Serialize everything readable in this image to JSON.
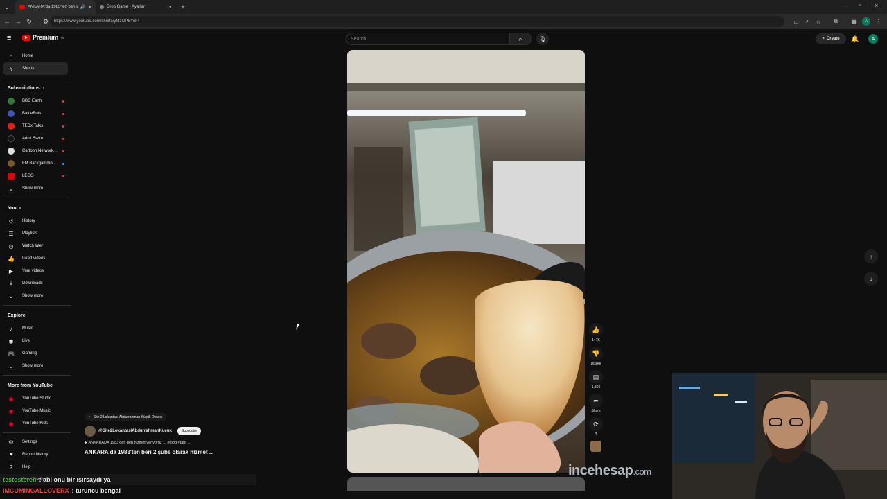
{
  "browser": {
    "tabs": [
      {
        "title": "ANKARA'da 1983'ten beri 2",
        "active": true
      },
      {
        "title": "Drop Game - Ayarlar",
        "active": false
      }
    ],
    "url": "https://www.youtube.com/shorts/yMzI2PEYek4"
  },
  "header": {
    "logo_text": "Premium",
    "logo_badge": "TR",
    "search_placeholder": "Search",
    "create_label": "Create",
    "avatar_letter": "A",
    "brand_color": "#ff0000"
  },
  "sidebar": {
    "main": [
      {
        "label": "Home",
        "icon": "home-icon"
      },
      {
        "label": "Shorts",
        "icon": "shorts-icon",
        "active": true
      }
    ],
    "subscriptions_title": "Subscriptions",
    "subscriptions": [
      {
        "label": "BBC Earth",
        "color": "#2e7d32"
      },
      {
        "label": "BattleBots",
        "color": "#3f51b5"
      },
      {
        "label": "TEDx Talks",
        "color": "#e62117"
      },
      {
        "label": "Adult Swim",
        "color": "#111111"
      },
      {
        "label": "Cartoon Network...",
        "color": "#dddddd"
      },
      {
        "label": "FM Backgammo...",
        "color": "#7a5a2a"
      },
      {
        "label": "LEGO",
        "color": "#e3000b"
      }
    ],
    "subs_show_more": "Show more",
    "you_title": "You",
    "you_items": [
      {
        "label": "History",
        "icon": "history-icon"
      },
      {
        "label": "Playlists",
        "icon": "playlists-icon"
      },
      {
        "label": "Watch later",
        "icon": "clock-icon"
      },
      {
        "label": "Liked videos",
        "icon": "thumbs-up-icon"
      },
      {
        "label": "Your videos",
        "icon": "video-icon"
      },
      {
        "label": "Downloads",
        "icon": "download-icon"
      }
    ],
    "you_show_more": "Show more",
    "explore_title": "Explore",
    "explore_items": [
      {
        "label": "Music",
        "icon": "music-icon"
      },
      {
        "label": "Live",
        "icon": "live-icon"
      },
      {
        "label": "Gaming",
        "icon": "gaming-icon"
      }
    ],
    "explore_show_more": "Show more",
    "more_title": "More from YouTube",
    "more_items": [
      {
        "label": "YouTube Studio"
      },
      {
        "label": "YouTube Music"
      },
      {
        "label": "YouTube Kids"
      }
    ],
    "footer_items": [
      {
        "label": "Settings",
        "icon": "gear-icon"
      },
      {
        "label": "Report history",
        "icon": "flag-icon"
      },
      {
        "label": "Help",
        "icon": "help-icon"
      },
      {
        "label": "Send feedback",
        "icon": "feedback-icon"
      }
    ]
  },
  "short": {
    "location": "Site 2 Lokantası Abdurrahman Küçük Ovacık",
    "channel": "@Site2LokantasiAbdurrahmanKucuk",
    "subscribe_label": "Subscribe",
    "description": "ANKARADA 1983'den beri hizmet veriyoruz ... #food #tarif ...",
    "title": "ANKARA'da 1983'ten beri 2 şube olarak hizmet ...",
    "likes": "147K",
    "dislike_label": "Dislike",
    "comments": "1,360",
    "share_label": "Share",
    "remix": "3"
  },
  "overlay": {
    "watermark_main": "incehesap",
    "watermark_suffix": ".com",
    "chat": [
      {
        "user": "testosteren",
        "message": ": abi onu bir ısırsaydı ya"
      },
      {
        "user": "IMCUMINGALLOVERX",
        "message": ": turuncu bengal"
      }
    ]
  }
}
